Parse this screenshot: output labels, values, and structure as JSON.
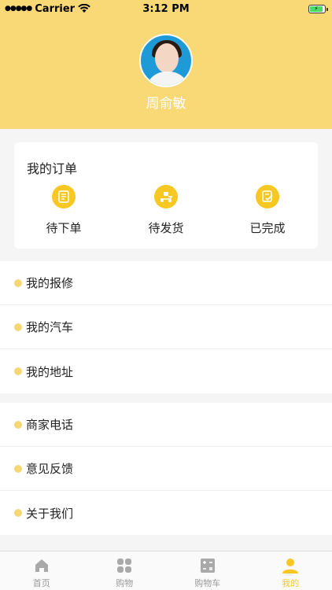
{
  "status": {
    "carrier": "Carrier",
    "time": "3:12 PM"
  },
  "profile": {
    "username": "周俞敏"
  },
  "orders": {
    "title": "我的订单",
    "items": [
      {
        "label": "待下单",
        "icon": "order-list-icon"
      },
      {
        "label": "待发货",
        "icon": "delivery-scooter-icon"
      },
      {
        "label": "已完成",
        "icon": "completed-order-icon"
      }
    ]
  },
  "menu_group1": [
    {
      "label": "我的报修"
    },
    {
      "label": "我的汽车"
    },
    {
      "label": "我的地址"
    }
  ],
  "menu_group2": [
    {
      "label": "商家电话"
    },
    {
      "label": "意见反馈"
    },
    {
      "label": "关于我们"
    }
  ],
  "tabbar": {
    "items": [
      {
        "label": "首页",
        "icon": "home-icon"
      },
      {
        "label": "购物",
        "icon": "grid-icon"
      },
      {
        "label": "购物车",
        "icon": "calculator-icon"
      },
      {
        "label": "我的",
        "icon": "user-icon"
      }
    ],
    "active_index": 3
  },
  "colors": {
    "accent": "#f7c823",
    "header": "#f9d976",
    "dot": "#f7d774"
  }
}
